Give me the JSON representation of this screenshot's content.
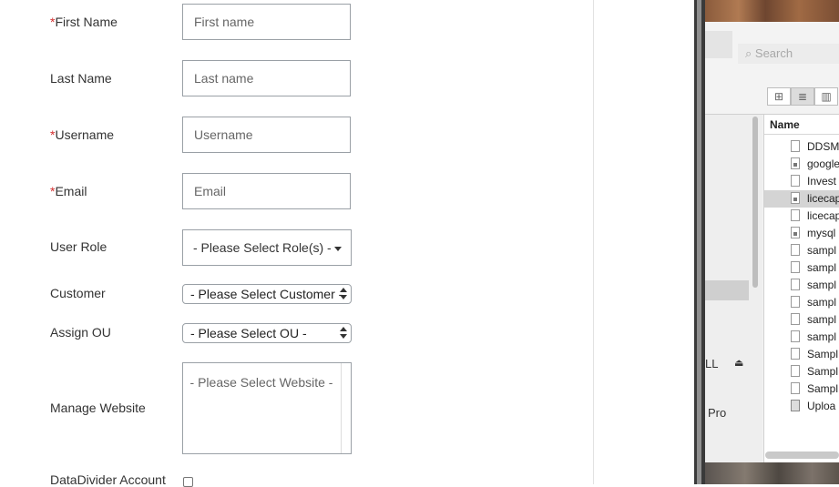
{
  "form": {
    "first_name": {
      "required_mark": "*",
      "label": "First Name",
      "placeholder": "First name"
    },
    "last_name": {
      "label": "Last Name",
      "placeholder": "Last name"
    },
    "username": {
      "required_mark": "*",
      "label": "Username",
      "placeholder": "Username"
    },
    "email": {
      "required_mark": "*",
      "label": "Email",
      "placeholder": "Email"
    },
    "user_role": {
      "label": "User Role",
      "value": "- Please Select Role(s) -"
    },
    "customer": {
      "label": "Customer",
      "value": "- Please Select Customer -"
    },
    "assign_ou": {
      "label": "Assign OU",
      "value": "- Please Select OU -"
    },
    "manage_website": {
      "label": "Manage Website",
      "option": "- Please Select Website -"
    },
    "datadivider": {
      "label": "DataDivider Account",
      "checked": false
    }
  },
  "finder": {
    "search_placeholder": "Search",
    "column_name": "Name",
    "files": [
      "DDSM",
      "google",
      "Invest",
      "licecap",
      "licecap",
      "mysql",
      "sampl",
      "sampl",
      "sampl",
      "sampl",
      "sampl",
      "sampl",
      "Sampl",
      "Sampl",
      "Sampl",
      "Uploa"
    ],
    "selected_index": 3,
    "sidebar_text_1": "LL",
    "sidebar_text_2": "Pro"
  },
  "icons": {
    "eject": "eject-icon",
    "grid_view": "grid-view-icon",
    "list_view": "list-view-icon",
    "column_view": "column-view-icon"
  },
  "colors": {
    "required": "#d32f2f",
    "border": "#9aa0a6"
  }
}
